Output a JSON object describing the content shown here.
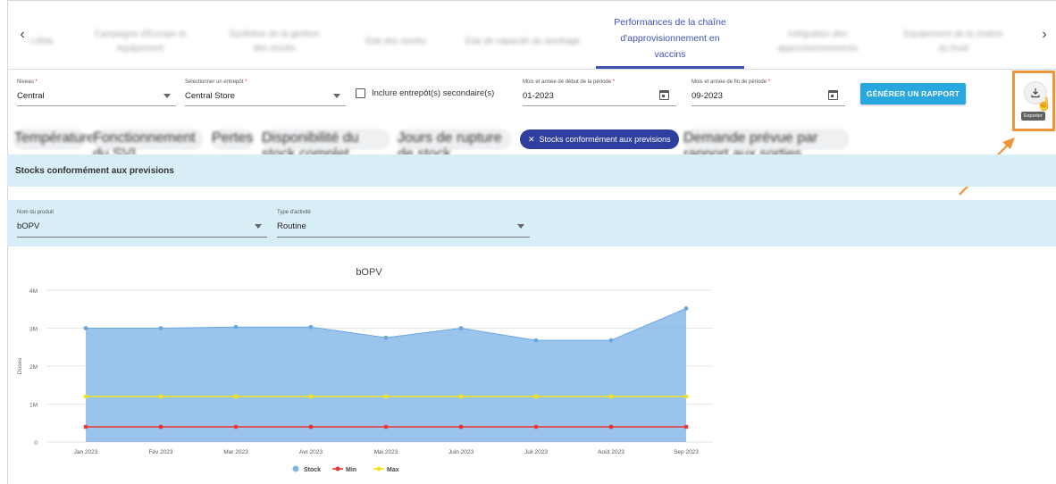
{
  "tabs": {
    "items": [
      {
        "label": "Lithia"
      },
      {
        "label": "Campagne d'Europe et équipement"
      },
      {
        "label": "Synthèse de la gestion des stocks"
      },
      {
        "label": "Etat des stocks"
      },
      {
        "label": "Etat de capacité de stockage"
      },
      {
        "label": "Performances de la chaîne d'approvisionnement en vaccins"
      },
      {
        "label": "Intégration des approvisionnements"
      },
      {
        "label": "Equipement de la chaîne du froid"
      }
    ],
    "active_line1": "Performances de la chaîne",
    "active_line2": "d'approvisionnement en",
    "active_line3": "vaccins"
  },
  "filters": {
    "niveau": {
      "label": "Niveau",
      "value": "Central"
    },
    "entrepot": {
      "label": "Sélectionner un entrepôt",
      "value": "Central Store"
    },
    "secondaire": {
      "label": "Inclure entrepôt(s) secondaire(s)",
      "checked": false
    },
    "debut": {
      "label": "Mois et année de début de la période",
      "value": "01-2023"
    },
    "fin": {
      "label": "Mois et année de fin de période",
      "value": "09-2023"
    },
    "required_mark": "*"
  },
  "generate_label": "GÉNÉRER UN RAPPORT",
  "export_tooltip": "Exporter",
  "chips": {
    "blurred": [
      "Température",
      "Fonctionnement du SVI",
      "Pertes",
      "Disponibilité du stock complet",
      "Jours de rupture de stock",
      "Demande prévue par rapport aux sorties"
    ],
    "active_label": "Stocks conformément aux previsions"
  },
  "section_title": "Stocks conformément aux previsions",
  "product": {
    "label": "Nom du produit",
    "value": "bOPV"
  },
  "activity": {
    "label": "Type d'activité",
    "value": "Routine"
  },
  "colors": {
    "accent": "#3f51b5",
    "chip_active": "#2f3f9f",
    "button": "#29a8e0",
    "section_bg": "#d8eef6",
    "highlight": "#f0943a",
    "stock": "#7fb4e8",
    "min": "#e53935",
    "max": "#f3e31a"
  },
  "chart_data": {
    "type": "area",
    "title": "bOPV",
    "ylabel": "Doses",
    "xlabel": "",
    "categories": [
      "Jan 2023",
      "Fév 2023",
      "Mar 2023",
      "Avr 2023",
      "Mai 2023",
      "Juin 2023",
      "Juil 2023",
      "Août 2023",
      "Sep 2023"
    ],
    "yticks": [
      "0",
      "1M",
      "2M",
      "3M",
      "4M"
    ],
    "ylim": [
      0,
      4000000
    ],
    "series": [
      {
        "name": "Stock",
        "type": "area",
        "color": "#7fb4e8",
        "values": [
          3000000,
          3000000,
          3030000,
          3030000,
          2750000,
          3000000,
          2680000,
          2680000,
          3520000
        ]
      },
      {
        "name": "Min",
        "type": "line",
        "color": "#e53935",
        "values": [
          400000,
          400000,
          400000,
          400000,
          400000,
          400000,
          400000,
          400000,
          400000
        ]
      },
      {
        "name": "Max",
        "type": "line",
        "color": "#f3e31a",
        "values": [
          1200000,
          1200000,
          1200000,
          1200000,
          1200000,
          1200000,
          1200000,
          1200000,
          1200000
        ]
      }
    ],
    "legend": "bottom",
    "grid": true
  }
}
